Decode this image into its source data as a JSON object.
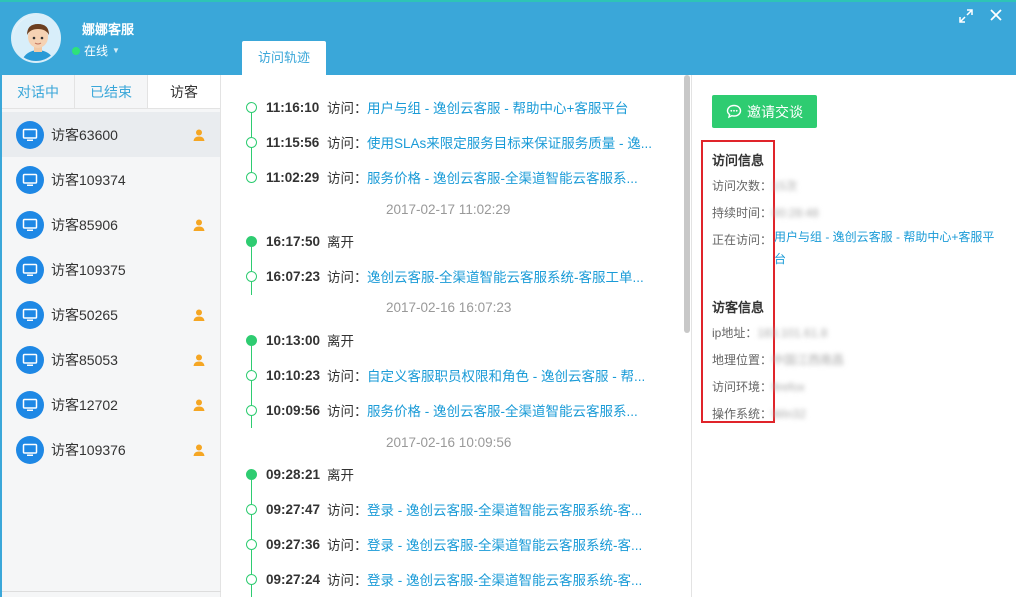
{
  "header": {
    "agent_name": "娜娜客服",
    "status": "在线",
    "tab_label": "访问轨迹"
  },
  "left": {
    "tabs": [
      "对话中",
      "已结束",
      "访客"
    ],
    "visitors": [
      {
        "name": "访客63600",
        "badge": true
      },
      {
        "name": "访客109374",
        "badge": false
      },
      {
        "name": "访客85906",
        "badge": true
      },
      {
        "name": "访客109375",
        "badge": false
      },
      {
        "name": "访客50265",
        "badge": true
      },
      {
        "name": "访客85053",
        "badge": true
      },
      {
        "name": "访客12702",
        "badge": true
      },
      {
        "name": "访客109376",
        "badge": true
      }
    ]
  },
  "timeline": [
    {
      "type": "visit",
      "time": "11:16:10",
      "action": "访问：",
      "link": "用户与组 - 逸创云客服 - 帮助中心+客服平台"
    },
    {
      "type": "visit",
      "time": "11:15:56",
      "action": "访问：",
      "link": "使用SLAs来限定服务目标来保证服务质量 - 逸..."
    },
    {
      "type": "visit",
      "time": "11:02:29",
      "action": "访问：",
      "link": "服务价格 - 逸创云客服-全渠道智能云客服系..."
    },
    {
      "type": "date",
      "text": "2017-02-17 11:02:29"
    },
    {
      "type": "leave",
      "time": "16:17:50",
      "action": "离开"
    },
    {
      "type": "visit",
      "time": "16:07:23",
      "action": "访问：",
      "link": "逸创云客服-全渠道智能云客服系统-客服工单..."
    },
    {
      "type": "date",
      "text": "2017-02-16 16:07:23"
    },
    {
      "type": "leave",
      "time": "10:13:00",
      "action": "离开"
    },
    {
      "type": "visit",
      "time": "10:10:23",
      "action": "访问：",
      "link": "自定义客服职员权限和角色 - 逸创云客服 - 帮..."
    },
    {
      "type": "visit",
      "time": "10:09:56",
      "action": "访问：",
      "link": "服务价格 - 逸创云客服-全渠道智能云客服系..."
    },
    {
      "type": "date",
      "text": "2017-02-16 10:09:56"
    },
    {
      "type": "leave",
      "time": "09:28:21",
      "action": "离开"
    },
    {
      "type": "visit",
      "time": "09:27:47",
      "action": "访问：",
      "link": "登录 - 逸创云客服-全渠道智能云客服系统-客..."
    },
    {
      "type": "visit",
      "time": "09:27:36",
      "action": "访问：",
      "link": "登录 - 逸创云客服-全渠道智能云客服系统-客..."
    },
    {
      "type": "visit",
      "time": "09:27:24",
      "action": "访问：",
      "link": "登录 - 逸创云客服-全渠道智能云客服系统-客..."
    }
  ],
  "right": {
    "invite_label": "邀请交谈",
    "visit_info_title": "访问信息",
    "visit_count_label": "访问次数：",
    "visit_count_value": "15次",
    "duration_label": "持续时间：",
    "duration_value": "00:28:48",
    "current_label": "正在访问：",
    "current_link": "用户与组 - 逸创云客服 - 帮助中心+客服平台",
    "visitor_info_title": "访客信息",
    "ip_label": "ip地址：",
    "ip_value": "183.101.61.8",
    "geo_label": "地理位置：",
    "geo_value": "中国江西南昌",
    "env_label": "访问环境：",
    "env_value": "firefox",
    "os_label": "操作系统：",
    "os_value": "Win32"
  },
  "colors": {
    "header": "#3aa7d9",
    "accent_green": "#2ecc71",
    "link": "#1a9bd7",
    "highlight_box": "#e0242a"
  }
}
